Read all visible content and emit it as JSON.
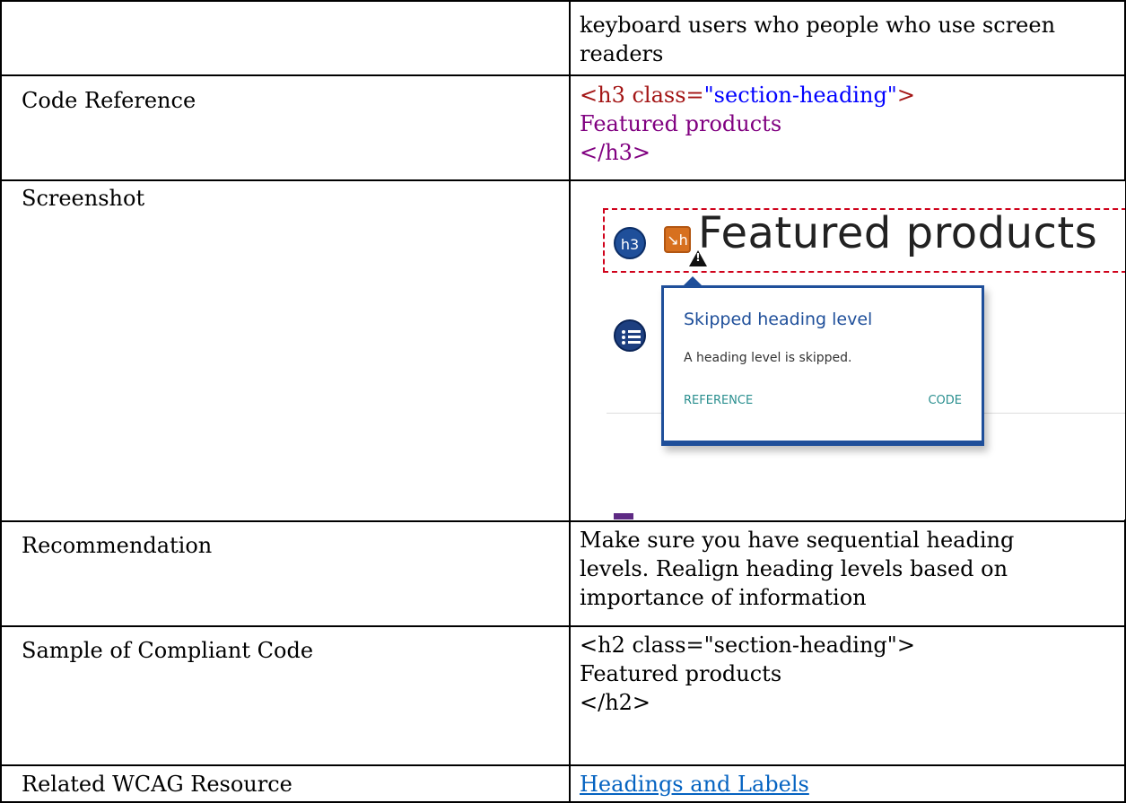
{
  "rows": [
    {
      "label": "",
      "value_lines": [
        "keyboard users who people who use screen",
        "readers"
      ]
    },
    {
      "label": "Code Reference"
    },
    {
      "label": "Screenshot"
    },
    {
      "label": "Recommendation",
      "value_lines": [
        "Make sure you have sequential heading",
        "levels. Realign heading levels based on",
        "importance of information"
      ]
    },
    {
      "label": "Sample of Compliant Code",
      "value_lines": [
        "<h2 class=\"section-heading\">",
        "Featured products",
        "</h2>"
      ]
    },
    {
      "label": "Related WCAG Resource",
      "link_text": "Headings and Labels"
    }
  ],
  "code_reference": {
    "open_tag_prefix": "<h3 class=",
    "class_value": "\"section-heading\"",
    "open_tag_suffix": ">",
    "content": "Featured products",
    "close_tag": "</h3>"
  },
  "screenshot": {
    "heading_badge": "h3",
    "heading_text": "Featured products",
    "popup_title": "Skipped heading level",
    "popup_message": "A heading level is skipped.",
    "reference_label": "REFERENCE",
    "code_label": "CODE"
  },
  "colors": {
    "tag": "#a31515",
    "attr_value": "#0000ff",
    "content": "#800080",
    "link": "#0563c1",
    "popup_accent": "#1f4f9a"
  }
}
